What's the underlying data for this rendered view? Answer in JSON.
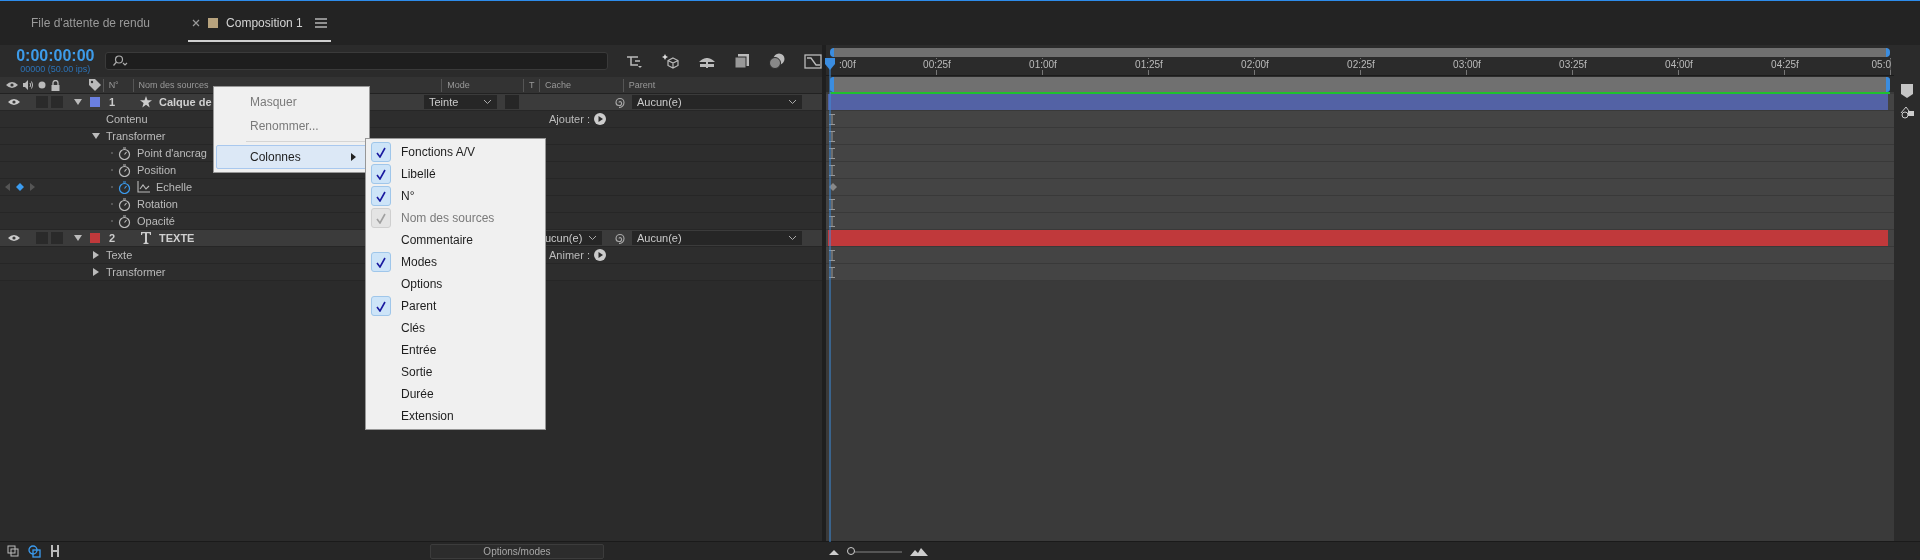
{
  "tabs": [
    {
      "label": "File d'attente de rendu",
      "selected": false
    },
    {
      "label": "Composition 1",
      "selected": true,
      "color": "#b8a37e"
    }
  ],
  "timecode": {
    "time": "0:00:00:00",
    "frames": "00000 (50.00 ips)"
  },
  "columns": [
    {
      "label": "N°"
    },
    {
      "label": "Nom des sources"
    },
    {
      "label": "Mode"
    },
    {
      "label": "T"
    },
    {
      "label": "Cache"
    },
    {
      "label": "Parent"
    }
  ],
  "layers": [
    {
      "number": "1",
      "name": "Calque de",
      "kind": "shape",
      "color": "#6a7fe0",
      "expanded": true,
      "audio": false,
      "solo": false,
      "preserve_transparency": false,
      "mode": "Teinte",
      "parent": "Aucun(e)",
      "children": [
        {
          "label": "Contenu",
          "kind": "item",
          "action": "Ajouter :"
        },
        {
          "label": "Transformer",
          "kind": "group",
          "expanded": true,
          "children": [
            {
              "label": "Point d'ancrag",
              "kind": "property",
              "animated": false
            },
            {
              "label": "Position",
              "kind": "property",
              "animated": false
            },
            {
              "label": "Echelle",
              "kind": "property",
              "animated": true
            },
            {
              "label": "Rotation",
              "kind": "property",
              "animated": false
            },
            {
              "label": "Opacité",
              "kind": "property",
              "animated": false
            }
          ]
        }
      ]
    },
    {
      "number": "2",
      "name": "TEXTE",
      "kind": "text",
      "color": "#c0393b",
      "expanded": true,
      "audio": false,
      "solo": false,
      "matte": "ucun(e)",
      "parent": "Aucun(e)",
      "children": [
        {
          "label": "Texte",
          "kind": "group",
          "expanded": false,
          "action": "Animer :"
        },
        {
          "label": "Transformer",
          "kind": "group",
          "expanded": false
        }
      ]
    }
  ],
  "ruler": [
    ":00f",
    "00:25f",
    "01:00f",
    "01:25f",
    "02:00f",
    "02:25f",
    "03:00f",
    "03:25f",
    "04:00f",
    "04:25f",
    "05:0"
  ],
  "context_menu": {
    "items": [
      {
        "label": "Masquer",
        "disabled": true,
        "selected": false
      },
      {
        "label": "Renommer...",
        "disabled": true,
        "selected": false
      },
      {
        "label": "Colonnes",
        "disabled": false,
        "selected": true
      }
    ],
    "submenu": [
      {
        "label": "Fonctions A/V",
        "checked": true,
        "disabled": false
      },
      {
        "label": "Libellé",
        "checked": true,
        "disabled": false
      },
      {
        "label": "N°",
        "checked": true,
        "disabled": false
      },
      {
        "label": "Nom des sources",
        "checked": true,
        "disabled": true
      },
      {
        "label": "Commentaire",
        "checked": false,
        "disabled": false
      },
      {
        "label": "Modes",
        "checked": true,
        "disabled": false
      },
      {
        "label": "Options",
        "checked": false,
        "disabled": false
      },
      {
        "label": "Parent",
        "checked": true,
        "disabled": false
      },
      {
        "label": "Clés",
        "checked": false,
        "disabled": false
      },
      {
        "label": "Entrée",
        "checked": false,
        "disabled": false
      },
      {
        "label": "Sortie",
        "checked": false,
        "disabled": false
      },
      {
        "label": "Durée",
        "checked": false,
        "disabled": false
      },
      {
        "label": "Extension",
        "checked": false,
        "disabled": false
      }
    ]
  },
  "bottom_bar": {
    "button": "Options/modes",
    "zoom": {
      "level": 0.08
    }
  }
}
